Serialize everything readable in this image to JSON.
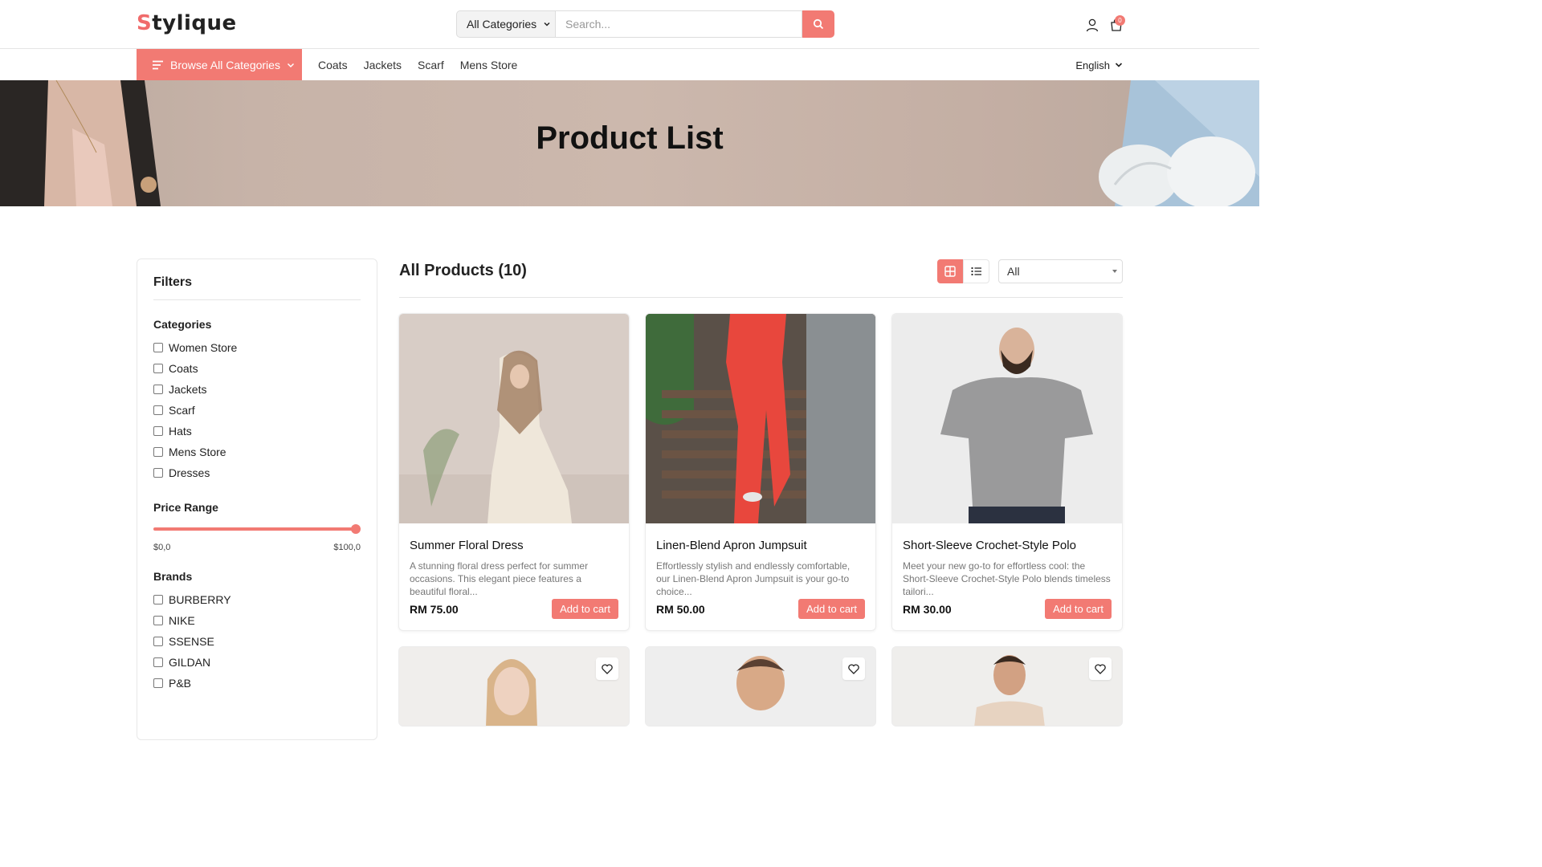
{
  "header": {
    "logo": "tylique",
    "logo_first": "S",
    "category_select": "All Categories",
    "search_placeholder": "Search...",
    "cart_count": "0"
  },
  "nav": {
    "browse_label": "Browse All Categories",
    "links": [
      "Coats",
      "Jackets",
      "Scarf",
      "Mens Store"
    ],
    "language": "English"
  },
  "banner": {
    "title": "Product List"
  },
  "filters": {
    "title": "Filters",
    "categories_title": "Categories",
    "categories": [
      "Women Store",
      "Coats",
      "Jackets",
      "Scarf",
      "Hats",
      "Mens Store",
      "Dresses"
    ],
    "price_title": "Price Range",
    "price_min": "$0,0",
    "price_max": "$100,0",
    "price_level": 1.0,
    "brands_title": "Brands",
    "brands": [
      "BURBERRY",
      "NIKE",
      "SSENSE",
      "GILDAN",
      "P&B"
    ]
  },
  "products": {
    "title": "All Products (10)",
    "sort_value": "All",
    "items": [
      {
        "name": "Summer Floral Dress",
        "desc": "A stunning floral dress perfect for summer occasions. This elegant piece features a beautiful floral...",
        "price": "RM 75.00",
        "cta": "Add to cart"
      },
      {
        "name": "Linen-Blend Apron Jumpsuit",
        "desc": "Effortlessly stylish and endlessly comfortable, our Linen-Blend Apron Jumpsuit is your go-to choice...",
        "price": "RM 50.00",
        "cta": "Add to cart"
      },
      {
        "name": "Short-Sleeve Crochet-Style Polo",
        "desc": "Meet your new go-to for effortless cool: the Short-Sleeve Crochet-Style Polo blends timeless tailori...",
        "price": "RM 30.00",
        "cta": "Add to cart"
      }
    ]
  },
  "colors": {
    "accent": "#f27a73"
  }
}
